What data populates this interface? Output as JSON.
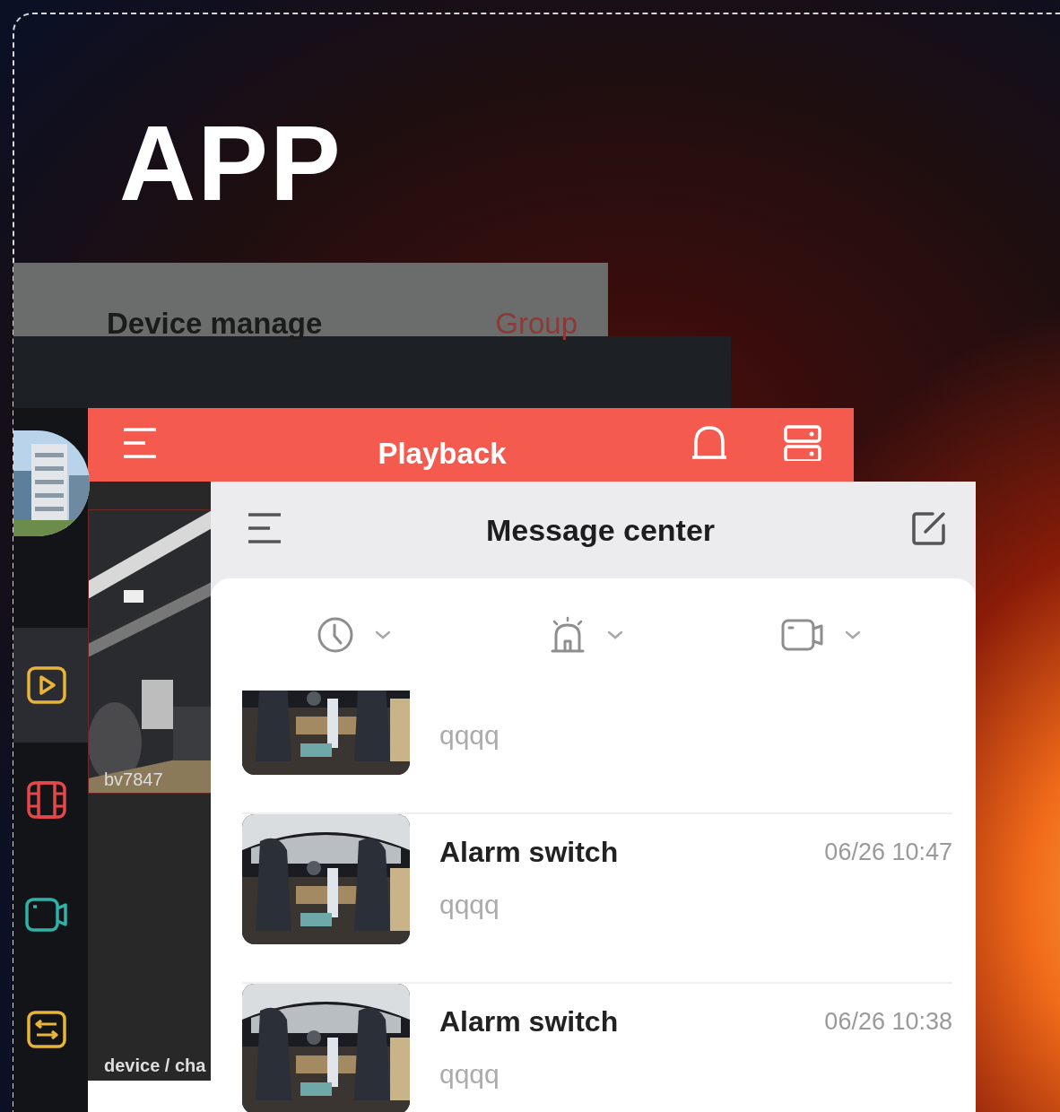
{
  "headline": "APP",
  "device_screen": {
    "title": "Device manage",
    "group_link": "Group"
  },
  "playback_screen": {
    "title": "Playback",
    "camera_label": "bv7847",
    "path_label": "device / cha",
    "sidebar": [
      {
        "kind": "play",
        "color": "#e8b43a",
        "selected": true
      },
      {
        "kind": "film",
        "color": "#e5484a",
        "selected": false
      },
      {
        "kind": "camera",
        "color": "#2fb3a8",
        "selected": false
      },
      {
        "kind": "settings",
        "color": "#e8b43a",
        "selected": false
      }
    ]
  },
  "message_screen": {
    "title": "Message center",
    "filters": [
      {
        "kind": "time"
      },
      {
        "kind": "alarm"
      },
      {
        "kind": "camera"
      }
    ],
    "messages": [
      {
        "description": "qqqq"
      },
      {
        "title": "Alarm switch",
        "time": "06/26 10:47",
        "description": "qqqq"
      },
      {
        "title": "Alarm switch",
        "time": "06/26 10:38",
        "description": "qqqq"
      }
    ]
  }
}
